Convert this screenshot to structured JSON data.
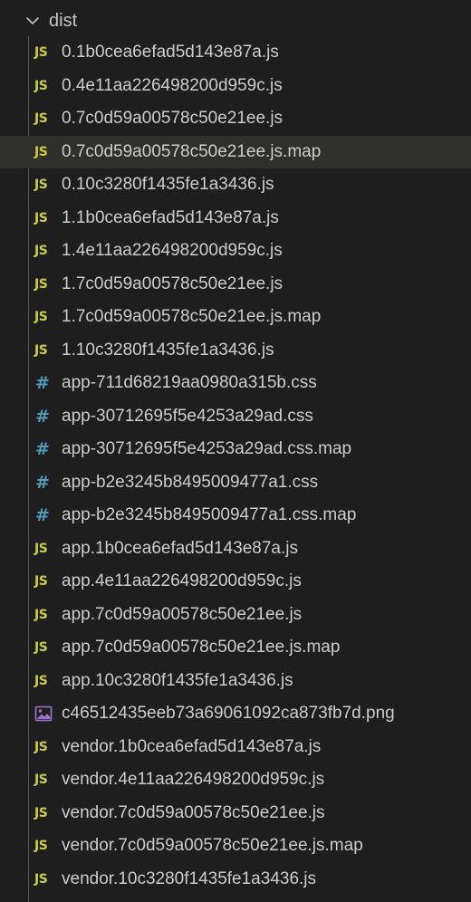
{
  "explorer": {
    "folder": {
      "name": "dist",
      "expanded": true
    },
    "files": [
      {
        "name": "0.1b0cea6efad5d143e87a.js",
        "type": "js",
        "icon": "js-icon",
        "state": ""
      },
      {
        "name": "0.4e11aa226498200d959c.js",
        "type": "js",
        "icon": "js-icon",
        "state": ""
      },
      {
        "name": "0.7c0d59a00578c50e21ee.js",
        "type": "js",
        "icon": "js-icon",
        "state": ""
      },
      {
        "name": "0.7c0d59a00578c50e21ee.js.map",
        "type": "js",
        "icon": "js-icon",
        "state": "hovered"
      },
      {
        "name": "0.10c3280f1435fe1a3436.js",
        "type": "js",
        "icon": "js-icon",
        "state": ""
      },
      {
        "name": "1.1b0cea6efad5d143e87a.js",
        "type": "js",
        "icon": "js-icon",
        "state": ""
      },
      {
        "name": "1.4e11aa226498200d959c.js",
        "type": "js",
        "icon": "js-icon",
        "state": ""
      },
      {
        "name": "1.7c0d59a00578c50e21ee.js",
        "type": "js",
        "icon": "js-icon",
        "state": ""
      },
      {
        "name": "1.7c0d59a00578c50e21ee.js.map",
        "type": "js",
        "icon": "js-icon",
        "state": ""
      },
      {
        "name": "1.10c3280f1435fe1a3436.js",
        "type": "js",
        "icon": "js-icon",
        "state": ""
      },
      {
        "name": "app-711d68219aa0980a315b.css",
        "type": "css",
        "icon": "hash-icon",
        "state": ""
      },
      {
        "name": "app-30712695f5e4253a29ad.css",
        "type": "css",
        "icon": "hash-icon",
        "state": ""
      },
      {
        "name": "app-30712695f5e4253a29ad.css.map",
        "type": "css",
        "icon": "hash-icon",
        "state": ""
      },
      {
        "name": "app-b2e3245b8495009477a1.css",
        "type": "css",
        "icon": "hash-icon",
        "state": ""
      },
      {
        "name": "app-b2e3245b8495009477a1.css.map",
        "type": "css",
        "icon": "hash-icon",
        "state": ""
      },
      {
        "name": "app.1b0cea6efad5d143e87a.js",
        "type": "js",
        "icon": "js-icon",
        "state": ""
      },
      {
        "name": "app.4e11aa226498200d959c.js",
        "type": "js",
        "icon": "js-icon",
        "state": ""
      },
      {
        "name": "app.7c0d59a00578c50e21ee.js",
        "type": "js",
        "icon": "js-icon",
        "state": ""
      },
      {
        "name": "app.7c0d59a00578c50e21ee.js.map",
        "type": "js",
        "icon": "js-icon",
        "state": ""
      },
      {
        "name": "app.10c3280f1435fe1a3436.js",
        "type": "js",
        "icon": "js-icon",
        "state": ""
      },
      {
        "name": "c46512435eeb73a69061092ca873fb7d.png",
        "type": "image",
        "icon": "image-icon",
        "state": ""
      },
      {
        "name": "vendor.1b0cea6efad5d143e87a.js",
        "type": "js",
        "icon": "js-icon",
        "state": ""
      },
      {
        "name": "vendor.4e11aa226498200d959c.js",
        "type": "js",
        "icon": "js-icon",
        "state": ""
      },
      {
        "name": "vendor.7c0d59a00578c50e21ee.js",
        "type": "js",
        "icon": "js-icon",
        "state": ""
      },
      {
        "name": "vendor.7c0d59a00578c50e21ee.js.map",
        "type": "js",
        "icon": "js-icon",
        "state": ""
      },
      {
        "name": "vendor.10c3280f1435fe1a3436.js",
        "type": "js",
        "icon": "js-icon",
        "state": ""
      }
    ],
    "icon_glyphs": {
      "js": "JS",
      "css": "#"
    },
    "colors": {
      "background": "#1e1e1e",
      "hover_row": "#2f3029",
      "text": "#cccccc",
      "js_icon": "#cbcb41",
      "css_icon": "#519aba",
      "image_icon": "#a074c4"
    }
  }
}
